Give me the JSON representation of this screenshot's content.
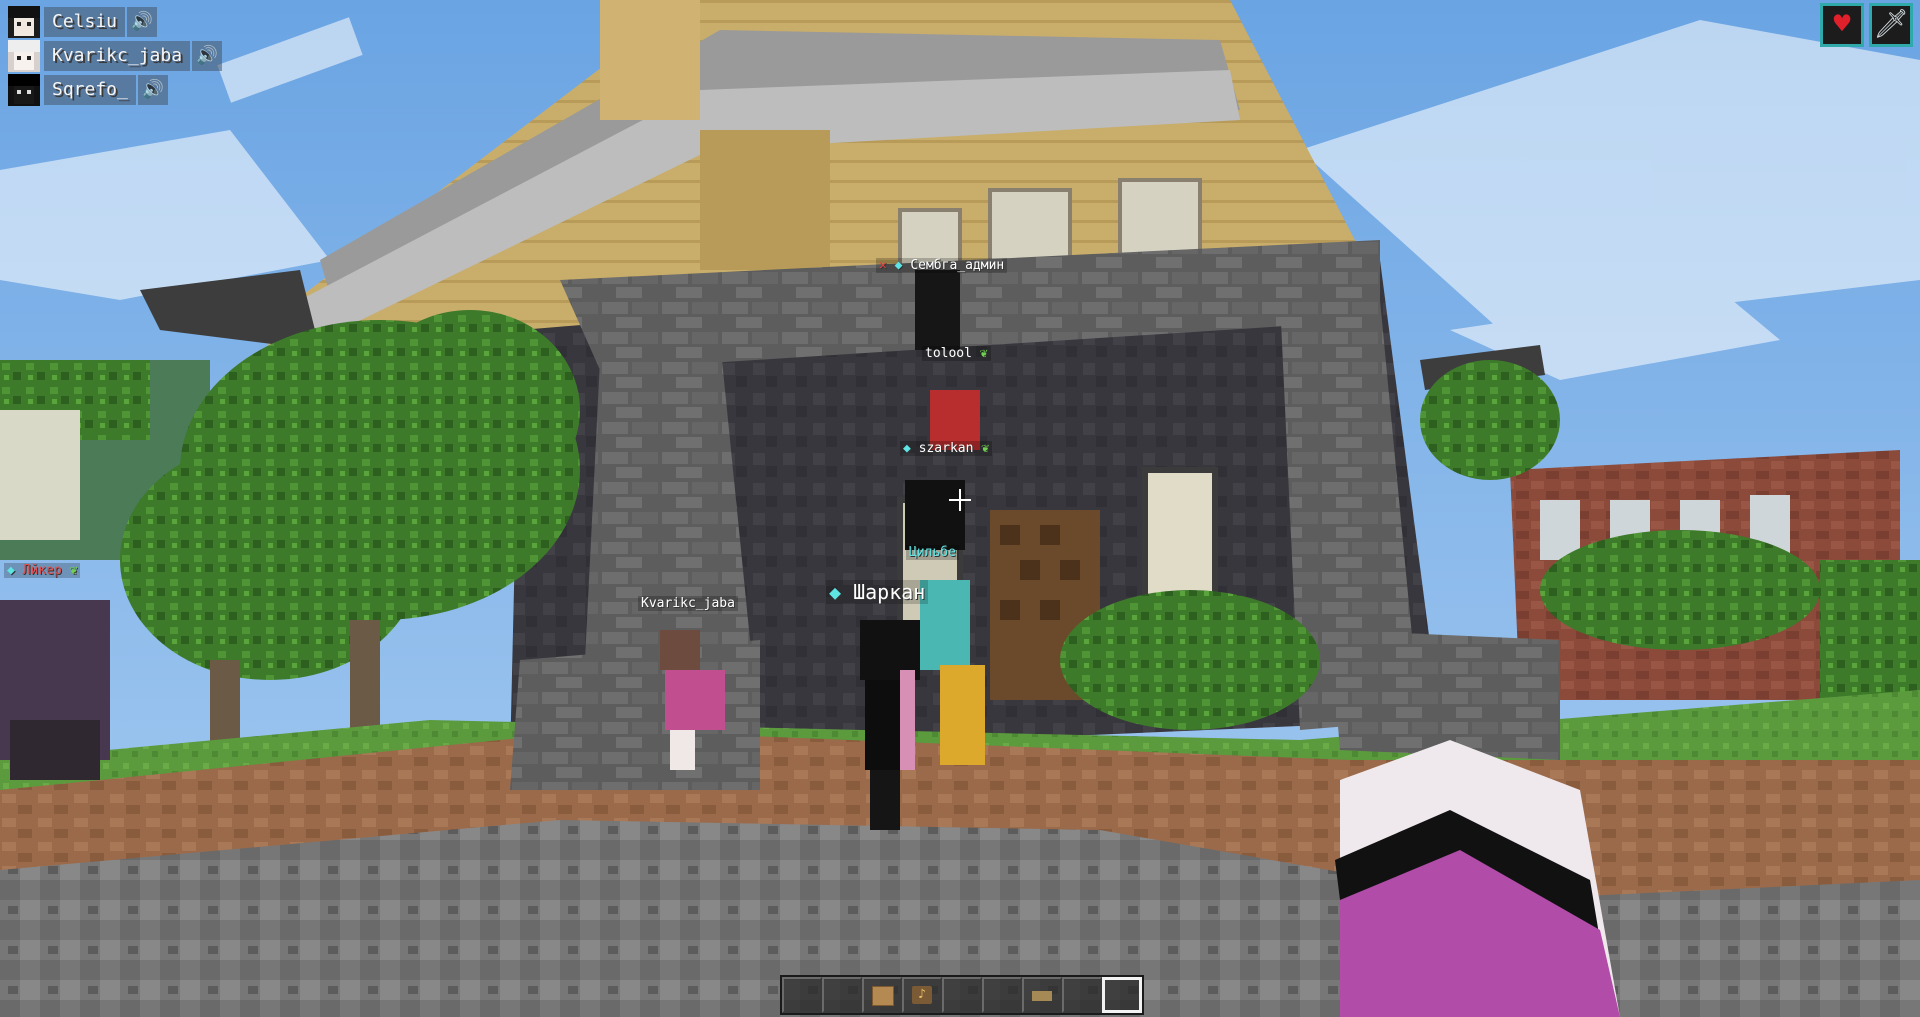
{
  "voice_chat": {
    "players": [
      {
        "name": "Celsiu"
      },
      {
        "name": "Kvarikc_jaba"
      },
      {
        "name": "Sqrefo_"
      }
    ]
  },
  "effects": [
    {
      "icon": "heart-icon",
      "color": "#e0202a"
    },
    {
      "icon": "sword-icon",
      "color": "#cfd8dc"
    }
  ],
  "nametags": {
    "admin": "Сембга_админ",
    "tolool": "tolool",
    "szarkan": "szarkan",
    "tsilbe": "Цильбе",
    "sharkan": "Шаркан",
    "kvarik": "Kvarikc_jaba",
    "liker": "Лйкер"
  },
  "hotbar": {
    "slots": [
      {
        "item": "",
        "selected": false
      },
      {
        "item": "",
        "selected": false
      },
      {
        "item": "oak-planks-icon",
        "selected": false
      },
      {
        "item": "music-disc-icon",
        "selected": false
      },
      {
        "item": "",
        "selected": false
      },
      {
        "item": "",
        "selected": false
      },
      {
        "item": "pressure-plate-icon",
        "selected": false
      },
      {
        "item": "",
        "selected": false
      },
      {
        "item": "",
        "selected": true
      }
    ]
  },
  "colors": {
    "sky": "#7fb2e8",
    "accent_frame": "#2fa9a9",
    "hand_sleeve": "#b14ca8"
  }
}
